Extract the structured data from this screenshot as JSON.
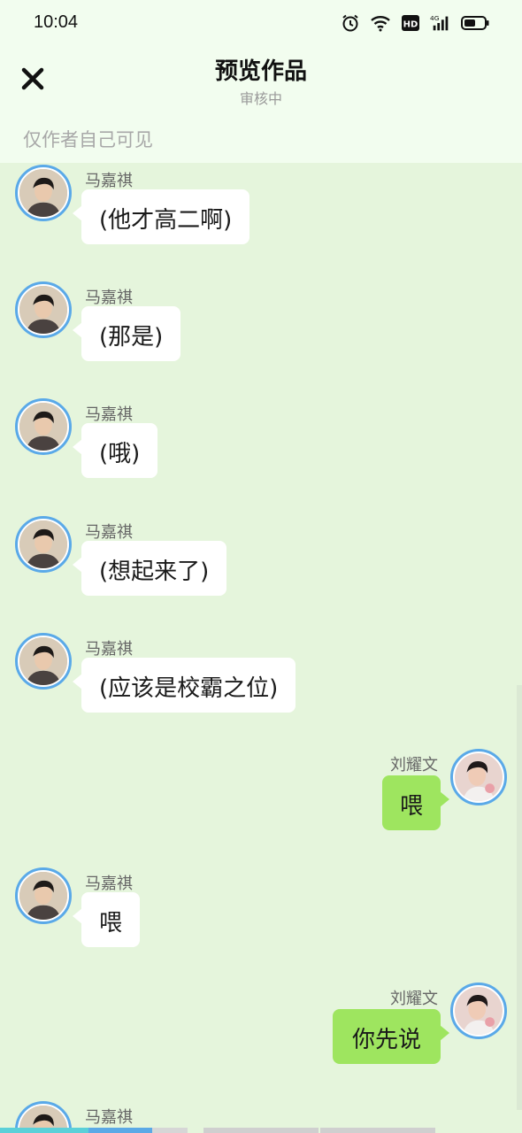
{
  "status_bar": {
    "time": "10:04",
    "icons": [
      "alarm-icon",
      "wifi-icon",
      "hd-icon",
      "signal-4g-icon",
      "battery-icon"
    ],
    "hd_text": "HD",
    "network_text": "4G"
  },
  "header": {
    "close_icon": "close-icon",
    "title": "预览作品",
    "subtitle": "审核中",
    "visibility_note": "仅作者自己可见"
  },
  "messages": [
    {
      "side": "left",
      "name": "马嘉祺",
      "text": "(他才高二啊)"
    },
    {
      "side": "left",
      "name": "马嘉祺",
      "text": "(那是)"
    },
    {
      "side": "left",
      "name": "马嘉祺",
      "text": "(哦)"
    },
    {
      "side": "left",
      "name": "马嘉祺",
      "text": "(想起来了)"
    },
    {
      "side": "left",
      "name": "马嘉祺",
      "text": "(应该是校霸之位)"
    },
    {
      "side": "right",
      "name": "刘耀文",
      "text": "喂"
    },
    {
      "side": "left",
      "name": "马嘉祺",
      "text": "喂"
    },
    {
      "side": "right",
      "name": "刘耀文",
      "text": "你先说"
    },
    {
      "side": "left",
      "name": "马嘉祺",
      "text": ""
    }
  ],
  "colors": {
    "chat_background": "#e5f5dc",
    "header_background": "#f2fdef",
    "left_bubble": "#ffffff",
    "right_bubble": "#9ee55f",
    "avatar_ring": "#5aa9e8"
  }
}
